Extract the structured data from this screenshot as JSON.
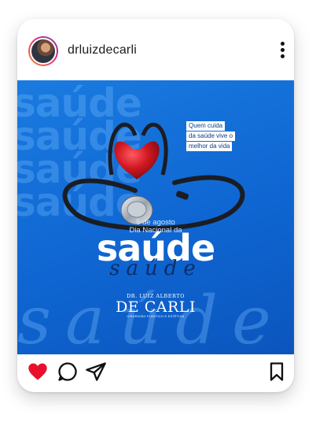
{
  "post": {
    "username": "drluizdecarli",
    "background_word": "saúde",
    "tagline": [
      "Quem cuida",
      "da saúde vive o",
      "melhor da vida"
    ],
    "date_line1": "5 de agosto",
    "date_line2": "Dia Nacional da",
    "title": "saúde",
    "title_script": "saúde",
    "logo_top": "DR. LUIZ ALBERTO",
    "logo_main": "DE CARLI",
    "logo_sub": "CIRURGIÃO PLÁSTICO E ESTÉTICA",
    "script_bottom": "saúde"
  },
  "colors": {
    "background": "#1272dc",
    "heart": "#d11822",
    "liked": "#e8112d",
    "accent_dark": "#0a2e6a"
  },
  "actions": {
    "like": "heart-icon",
    "comment": "comment-icon",
    "share": "send-icon",
    "save": "bookmark-icon"
  }
}
